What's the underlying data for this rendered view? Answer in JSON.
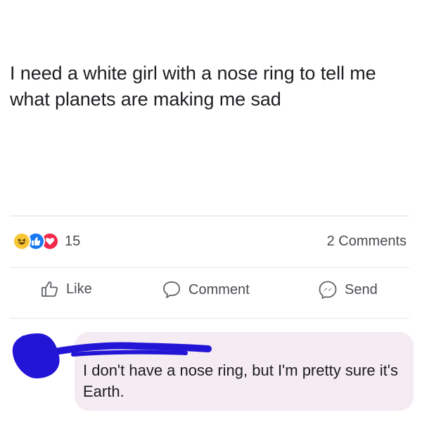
{
  "post": {
    "text": "I need a white girl with a nose ring to tell me what planets are making me sad"
  },
  "reactions": {
    "types": [
      "haha",
      "like",
      "love"
    ],
    "count": "15"
  },
  "comments_count": "2 Comments",
  "actions": {
    "like": "Like",
    "comment": "Comment",
    "send": "Send"
  },
  "comment": {
    "text": "I don't have a nose ring, but I'm pretty sure it's Earth."
  },
  "colors": {
    "scribble": "#2315d6",
    "bubble": "#f5ebf2",
    "like_blue": "#1877f2",
    "love_red": "#f0284a",
    "haha_yellow": "#f7c637"
  }
}
